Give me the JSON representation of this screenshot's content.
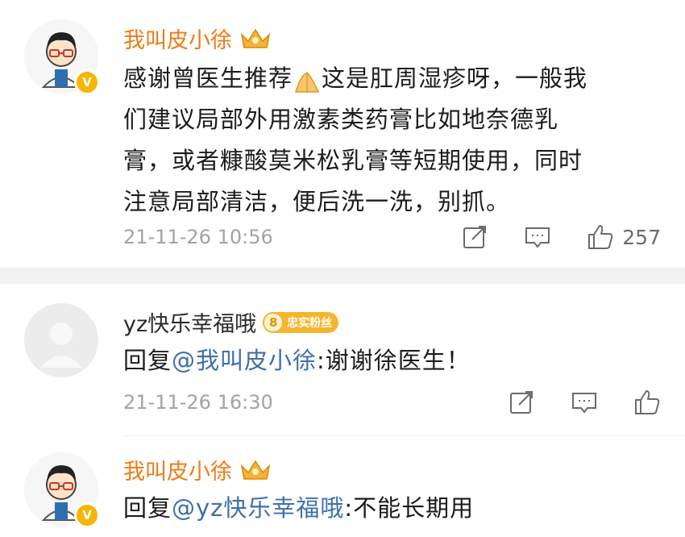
{
  "comments": [
    {
      "username": "我叫皮小徐",
      "verified": true,
      "badge_icon": "vip-crown-icon",
      "text": "感谢曾医生推荐",
      "emoji": "pray-hands-emoji",
      "text2_line1": "这是肛周湿疹呀，一般我",
      "text_line2": "们建议局部外用激素类药膏比如地奈德乳",
      "text_line3": "膏，或者糠酸莫米松乳膏等短期使用，同时",
      "text_line4": "注意局部清洁，便后洗一洗，别抓。",
      "timestamp": "21-11-26 10:56",
      "like_count": "257"
    },
    {
      "username": "yz快乐幸福哦",
      "fan_badge_level": "8",
      "fan_badge_text": "忠实粉丝",
      "reply_prefix": "回复",
      "mention": "@我叫皮小徐",
      "reply_text": ":谢谢徐医生！",
      "timestamp": "21-11-26 16:30"
    },
    {
      "username": "我叫皮小徐",
      "verified": true,
      "badge_icon": "vip-crown-icon",
      "reply_prefix": "回复",
      "mention": "@yz快乐幸福哦",
      "reply_text": ":不能长期用"
    }
  ],
  "colors": {
    "vip_name": "#ef7b14",
    "mention": "#3f6fab",
    "timestamp": "#a3a3a3",
    "verified_badge": "#f7b500"
  }
}
